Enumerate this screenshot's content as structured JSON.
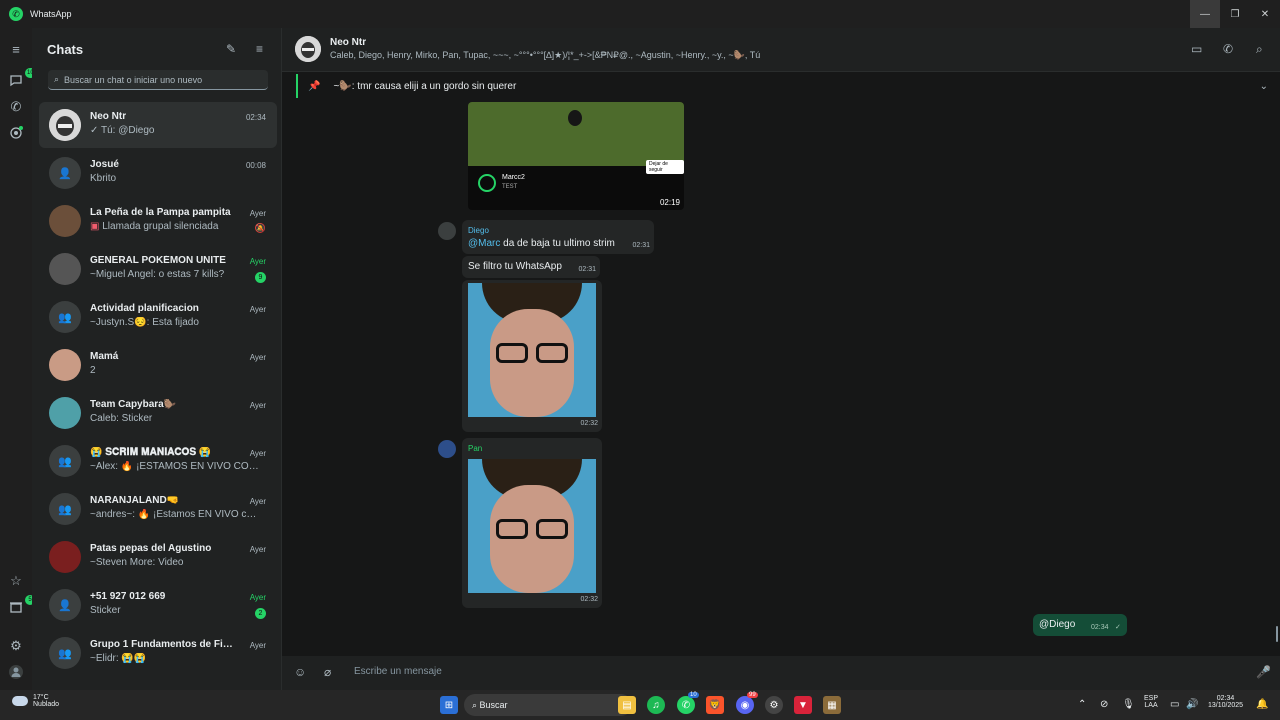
{
  "window": {
    "title": "WhatsApp"
  },
  "rail": {
    "chats_badge": "10",
    "status_badge": "",
    "archive_badge": "5"
  },
  "chatlist": {
    "title": "Chats",
    "search_placeholder": "Buscar un chat o iniciar uno nuevo",
    "items": [
      {
        "name": "Neo Ntr",
        "preview": "✓ Tú: @Diego",
        "time": "02:34",
        "time_green": false,
        "badge": ""
      },
      {
        "name": "Josué",
        "preview": "Kbrito",
        "time": "00:08",
        "time_green": false,
        "badge": ""
      },
      {
        "name": "La Peña de la Pampa pampita",
        "preview": "Llamada grupal silenciada",
        "time": "Ayer",
        "time_green": false,
        "badge": "",
        "muted": true
      },
      {
        "name": "GENERAL POKÉMON UNITE",
        "preview": "~Miguel Angel: o estas 7 kills?",
        "time": "Ayer",
        "time_green": true,
        "badge": "9"
      },
      {
        "name": "Actividad planificacion",
        "preview": "~Justyn.S😔: Esta fijado",
        "time": "Ayer",
        "time_green": false,
        "badge": ""
      },
      {
        "name": "Mamá",
        "preview": "2",
        "time": "Ayer",
        "time_green": false,
        "badge": ""
      },
      {
        "name": "Team Capybara🦫",
        "preview": "Caleb: Sticker",
        "time": "Ayer",
        "time_green": false,
        "badge": ""
      },
      {
        "name": "😭 𝐒𝐂𝐑𝐈𝐌 𝐌𝐀𝐍𝐈𝐀𝐂𝐎𝐒 😭",
        "preview": "~Alex: 🔥 ¡ESTAMOS EN VIVO CON...",
        "time": "Ayer",
        "time_green": false,
        "badge": ""
      },
      {
        "name": "NARANJALAND🤜",
        "preview": "~andres~: 🔥 ¡Estamos EN VIVO co...",
        "time": "Ayer",
        "time_green": false,
        "badge": ""
      },
      {
        "name": "Patas pepas del Agustino",
        "preview": "~Steven More: Video",
        "time": "Ayer",
        "time_green": false,
        "badge": ""
      },
      {
        "name": "+51 927 012 669",
        "preview": "Sticker",
        "time": "Ayer",
        "time_green": true,
        "badge": "2"
      },
      {
        "name": "Grupo 1 Fundamentos de Fina...",
        "preview": "~Elidr: 😭😭",
        "time": "Ayer",
        "time_green": false,
        "badge": ""
      }
    ]
  },
  "conversation": {
    "name": "Neo Ntr",
    "members": "Caleb, Diego, Henry, Mirko, Pan, Tupac, ~~~, ~°°°•°°°[∆]★)/¦*_+->[&₱N₽@., ~Agustin, ~Henry., ~y., ~🦫, Tú",
    "pinned": "~🦫: tmr causa eliji a un gordo sin querer",
    "messages": {
      "video_player_name": "Marcc2",
      "video_player_sub": "TEST",
      "video_button": "Dejar de seguir",
      "video_time": "02:19",
      "diego_sender": "Diego",
      "diego_mention": "@Marc",
      "diego_text": " da de baja tu ultimo strim",
      "diego_time": "02:31",
      "filtro_text": "Se filtro tu WhatsApp",
      "filtro_time": "02:31",
      "img1_time": "02:32",
      "pan_sender": "Pan",
      "img2_time": "02:32",
      "out_text": "@Diego",
      "out_time": "02:34"
    },
    "composer_placeholder": "Escribe un mensaje"
  },
  "taskbar": {
    "weather_temp": "17°C",
    "weather_desc": "Nublado",
    "search": "Buscar",
    "whatsapp_badge": "10",
    "discord_badge": "99",
    "lang": "ESP",
    "layout": "LAA",
    "time": "02:34",
    "date": "13/10/2025"
  }
}
